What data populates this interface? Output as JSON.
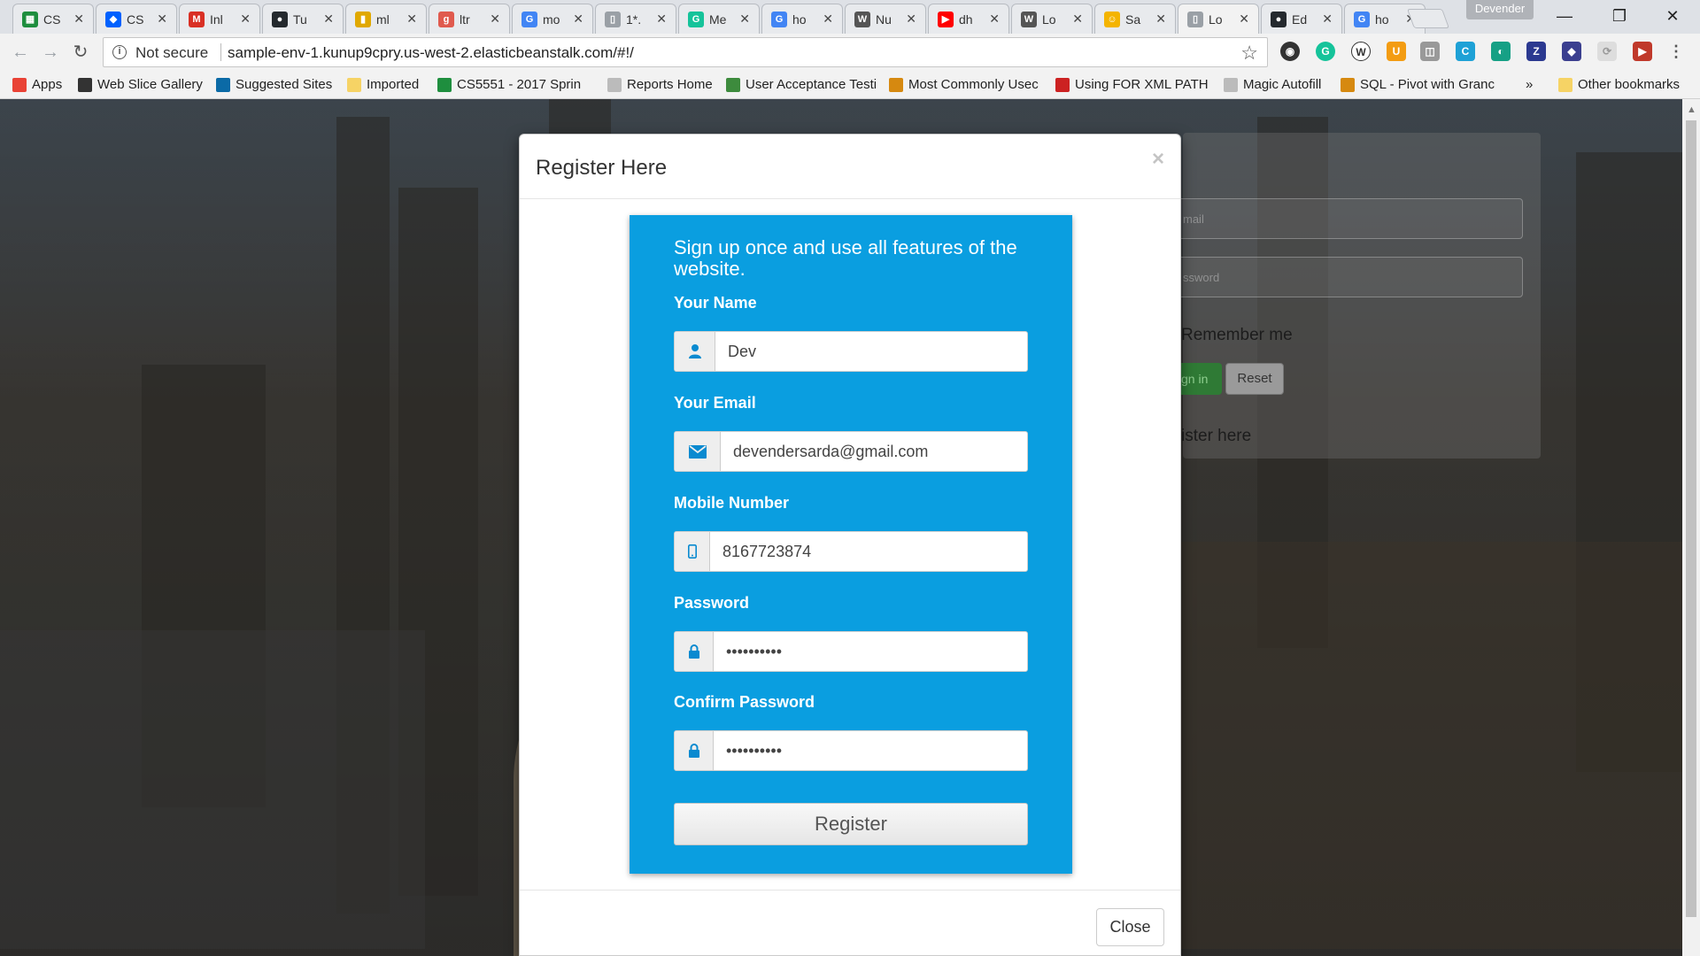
{
  "browser": {
    "tabs": [
      {
        "label": "CS",
        "icon": "sheets-icon",
        "color": "#1e8e3e"
      },
      {
        "label": "CS",
        "icon": "dropbox-icon",
        "color": "#0061fe"
      },
      {
        "label": "Inl",
        "icon": "gmail-icon",
        "color": "#d93025"
      },
      {
        "label": "Tu",
        "icon": "github-icon",
        "color": "#24292e"
      },
      {
        "label": "ml",
        "icon": "bookmark-icon",
        "color": "#e0a800"
      },
      {
        "label": "ltr",
        "icon": "g-icon",
        "color": "#e05a4e"
      },
      {
        "label": "mo",
        "icon": "google-icon",
        "color": "#4285f4"
      },
      {
        "label": "1*.",
        "icon": "page-icon",
        "color": "#9aa0a6"
      },
      {
        "label": "Me",
        "icon": "grammarly-icon",
        "color": "#15c39a"
      },
      {
        "label": "ho",
        "icon": "google-icon",
        "color": "#4285f4"
      },
      {
        "label": "Nu",
        "icon": "ws-icon",
        "color": "#555555"
      },
      {
        "label": "dh",
        "icon": "youtube-icon",
        "color": "#ff0000"
      },
      {
        "label": "Lo",
        "icon": "ws-icon",
        "color": "#555555"
      },
      {
        "label": "Sa",
        "icon": "smiley-icon",
        "color": "#f4b400"
      },
      {
        "label": "Lo",
        "icon": "page-icon",
        "color": "#9aa0a6"
      },
      {
        "label": "Ed",
        "icon": "github-icon",
        "color": "#24292e"
      },
      {
        "label": "ho",
        "icon": "google-icon",
        "color": "#4285f4"
      }
    ],
    "active_tab_index": 14,
    "profile_name": "Devender",
    "security_label": "Not secure",
    "url": "sample-env-1.kunup9cpry.us-west-2.elasticbeanstalk.com/#!/",
    "bookmarks": [
      {
        "label": "Apps",
        "icon": "apps-icon",
        "color": "#e94235"
      },
      {
        "label": "Web Slice Gallery",
        "icon": "webslice-icon",
        "color": "#333333"
      },
      {
        "label": "Suggested Sites",
        "icon": "bing-icon",
        "color": "#0b6aa6"
      },
      {
        "label": "Imported",
        "icon": "folder-icon",
        "color": "#f6d365"
      },
      {
        "label": "CS5551 - 2017 Sprin",
        "icon": "sheets-icon",
        "color": "#1e8e3e"
      },
      {
        "label": "Reports Home",
        "icon": "page-icon",
        "color": "#bbbbbb"
      },
      {
        "label": "User Acceptance Testi",
        "icon": "bug-icon",
        "color": "#3d8b3d"
      },
      {
        "label": "Most Commonly Usec",
        "icon": "so-icon",
        "color": "#d68910"
      },
      {
        "label": "Using FOR XML PATH",
        "icon": "globe-icon",
        "color": "#cc2222"
      },
      {
        "label": "Magic Autofill",
        "icon": "page-icon",
        "color": "#bbbbbb"
      },
      {
        "label": "SQL - Pivot with Granc",
        "icon": "so-icon",
        "color": "#d68910"
      }
    ],
    "bookmarks_overflow": "»",
    "other_bookmarks": "Other bookmarks"
  },
  "background_login": {
    "email_placeholder": "mail",
    "password_placeholder": "ssword",
    "remember_label": "Remember me",
    "signin_label": "gn in",
    "reset_label": "Reset",
    "register_link": "ister here"
  },
  "modal": {
    "title": "Register Here",
    "close_x": "×",
    "heading": "Sign up once and use all features of the website.",
    "fields": [
      {
        "label": "Your Name",
        "value": "Dev",
        "icon": "user-icon"
      },
      {
        "label": "Your Email",
        "value": "devendersarda@gmail.com",
        "icon": "envelope-icon"
      },
      {
        "label": "Mobile Number",
        "value": "8167723874",
        "icon": "mobile-icon"
      },
      {
        "label": "Password",
        "value": "••••••••••",
        "icon": "lock-icon"
      },
      {
        "label": "Confirm Password",
        "value": "••••••••••",
        "icon": "lock-icon"
      }
    ],
    "register_button": "Register",
    "close_button": "Close"
  },
  "colors": {
    "signup_panel": "#0a9ee0",
    "icon_accent": "#0a8ad0",
    "signin_green": "#2f7a35"
  }
}
